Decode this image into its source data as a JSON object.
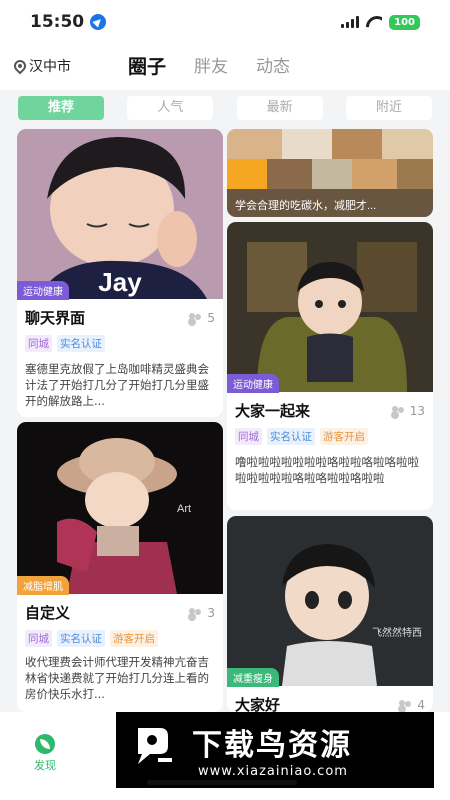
{
  "status_bar": {
    "time": "15:50",
    "battery": "100"
  },
  "header": {
    "city": "汉中市",
    "tabs": [
      {
        "label": "圈子"
      },
      {
        "label": "胖友"
      },
      {
        "label": "动态"
      }
    ]
  },
  "sub_tabs": [
    {
      "label": "推荐"
    },
    {
      "label": "人气"
    },
    {
      "label": "最新"
    },
    {
      "label": "附近"
    }
  ],
  "cards": [
    {
      "category": "运动健康",
      "image_text": "Jay",
      "title": "聊天界面",
      "count": "5",
      "tags": [
        "同城",
        "实名认证"
      ],
      "desc": "塞德里克放假了上岛咖啡精灵盛典会计法了开始打几分了开始打几分里盛开的解放路上..."
    },
    {
      "caption": "学会合理的吃碳水，减肥才..."
    },
    {
      "category": "运动健康",
      "title": "大家一起来",
      "count": "13",
      "tags": [
        "同城",
        "实名认证",
        "游客开启"
      ],
      "desc": "噜啦啦啦啦啦啦啦咯啦啦咯啦咯啦啦啦啦啦啦啦咯啦咯啦啦咯啦啦"
    },
    {
      "category": "减脂增肌",
      "image_text": "Art",
      "title": "自定义",
      "count": "3",
      "tags": [
        "同城",
        "实名认证",
        "游客开启"
      ],
      "desc": "收代理费会计师代理开发精神亢奋吉林省快递费就了开始打几分连上看的房价快乐水打..."
    },
    {
      "category": "减重瘦身",
      "image_text": "飞然然特西",
      "title": "大家好",
      "count": "4"
    }
  ],
  "tabbar": {
    "discover": "发现"
  },
  "watermark": {
    "main": "下载鸟资源",
    "url": "www.xiazainiao.com"
  },
  "colors": {
    "accent": "#6fd59c",
    "tag_bg": "#7c5cd6",
    "orange_tag_bg": "#f2a23a",
    "green_tag_bg": "#3cb878"
  }
}
